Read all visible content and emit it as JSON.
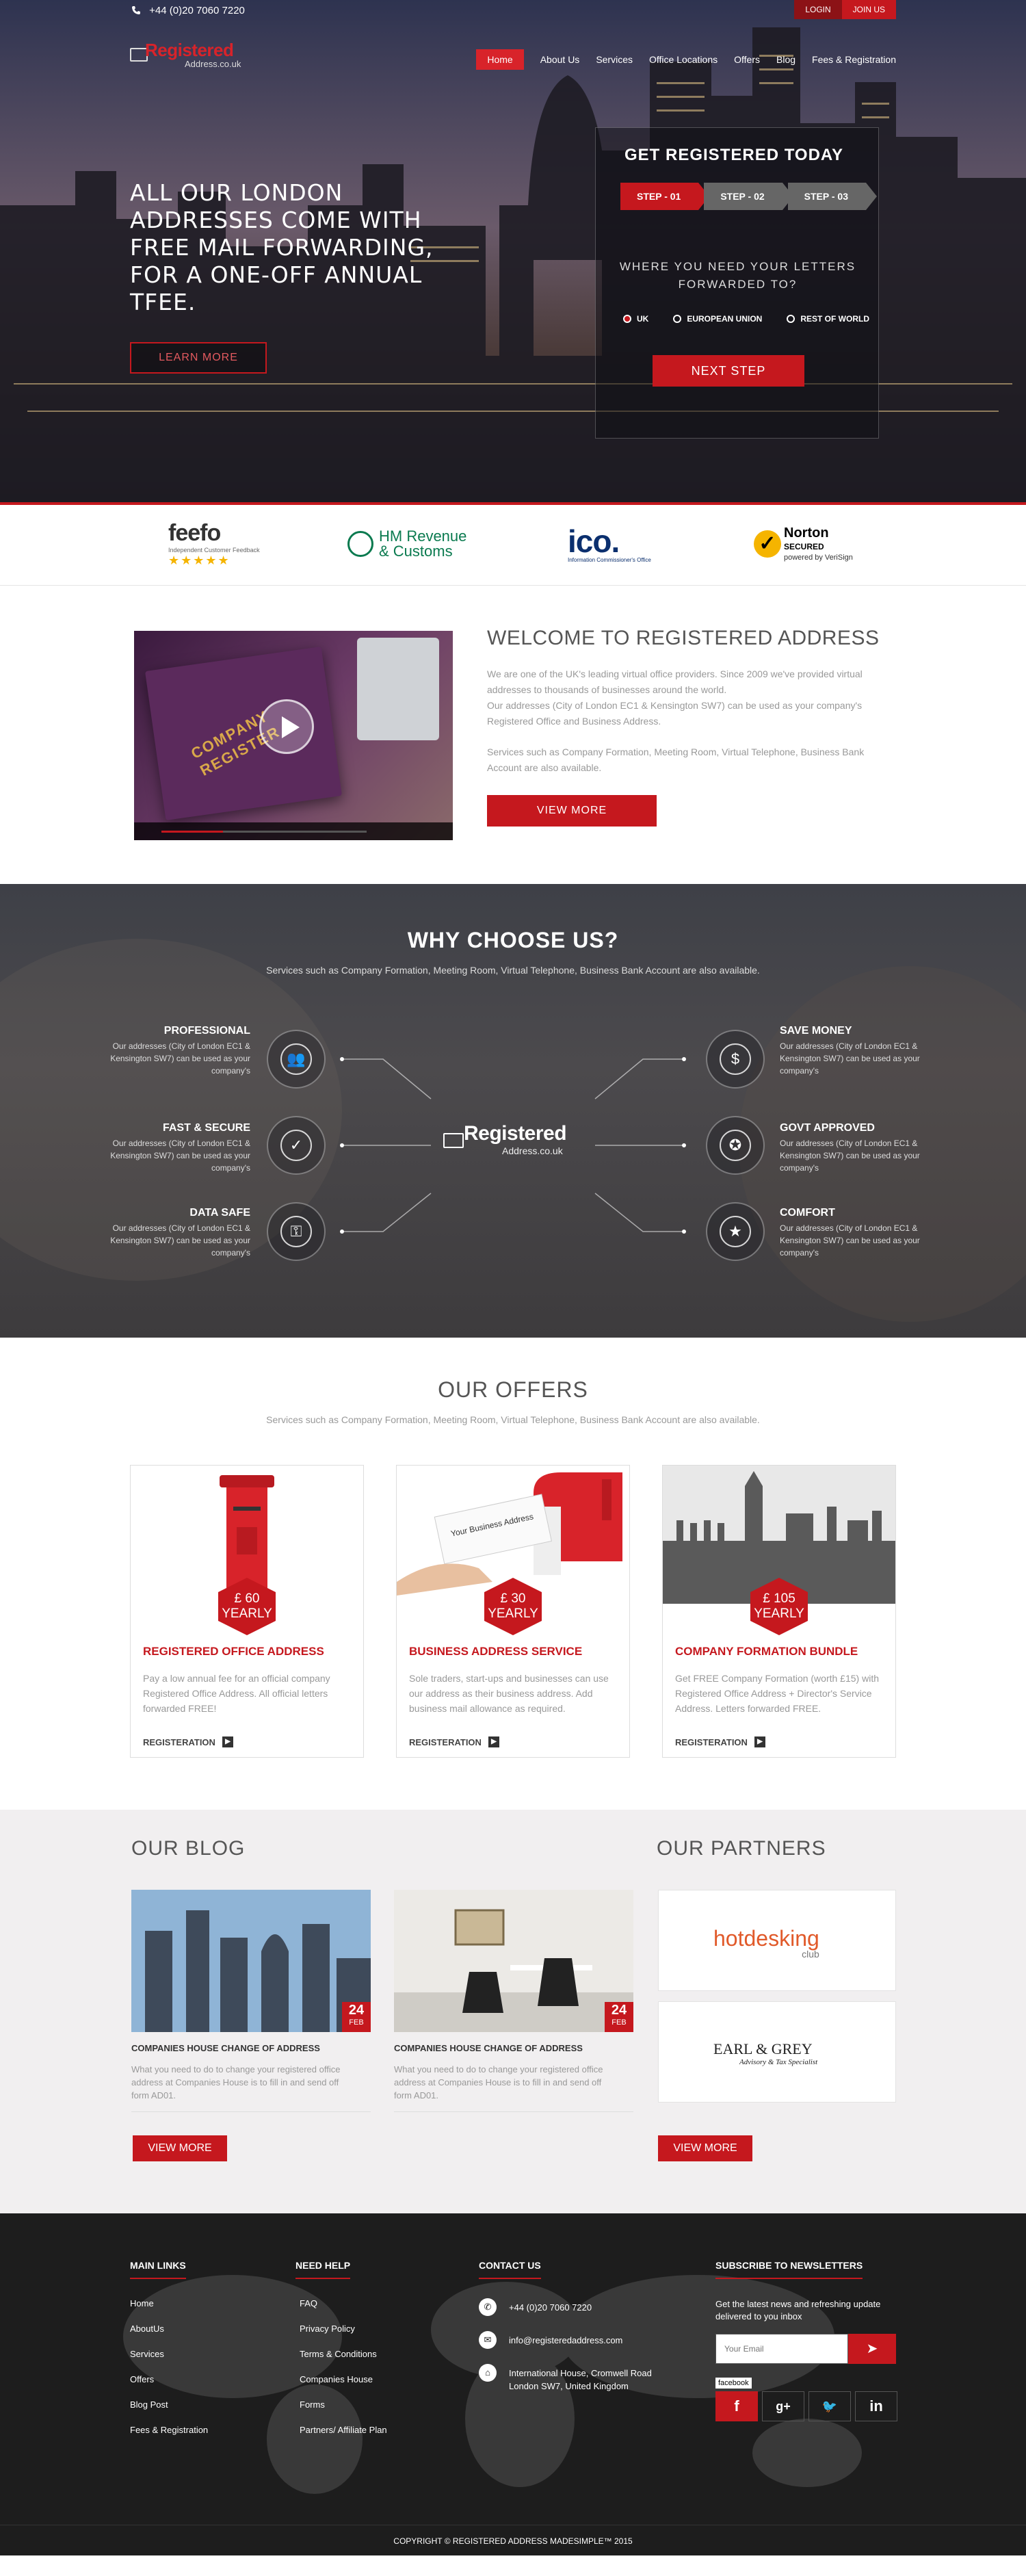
{
  "topbar": {
    "phone": "+44 (0)20 7060 7220",
    "login": "LOGIN",
    "join": "JOIN US"
  },
  "logo": {
    "brand": "Registered",
    "sub": "Address.co.uk"
  },
  "nav": {
    "items": [
      "Home",
      "About Us",
      "Services",
      "Office Locations",
      "Offers",
      "Blog",
      "Fees & Registration"
    ],
    "active": "Home"
  },
  "hero": {
    "headline": "ALL OUR LONDON ADDRESSES COME WITH FREE MAIL FORWARDING, FOR A ONE-OFF ANNUAL TFEE.",
    "learn_more": "LEARN MORE"
  },
  "register": {
    "title": "GET REGISTERED TODAY",
    "steps": [
      "STEP - 01",
      "STEP - 02",
      "STEP - 03"
    ],
    "question": "WHERE YOU NEED YOUR LETTERS FORWARDED TO?",
    "regions": [
      "UK",
      "EUROPEAN UNION",
      "REST OF WORLD"
    ],
    "next": "NEXT STEP"
  },
  "partners_strip": {
    "feefo": {
      "name": "feefo",
      "tag": "Independent Customer Feedback",
      "stars": "★★★★★"
    },
    "hmrc": {
      "line1": "HM Revenue",
      "line2": "& Customs"
    },
    "ico": {
      "name": "ico.",
      "tag": "Information Commissioner's Office"
    },
    "norton": {
      "name": "Norton",
      "line2": "SECURED",
      "tag": "powered by VeriSign"
    }
  },
  "welcome": {
    "title": "WELCOME TO REGISTERED ADDRESS",
    "p1": "We are one of the UK's leading virtual office providers. Since 2009 we've provided virtual addresses to thousands of businesses around the world.",
    "p2": "Our addresses (City of London EC1 & Kensington SW7) can be used as your company's Registered Office and Business Address.",
    "p3": "Services such as Company Formation, Meeting Room, Virtual Telephone, Business Bank Account are also available.",
    "button": "VIEW MORE",
    "video_text": "COMPANY REGISTER"
  },
  "why": {
    "title": "WHY CHOOSE US?",
    "subtitle": "Services such as Company Formation, Meeting Room, Virtual Telephone, Business Bank Account are also available.",
    "desc": "Our addresses (City of London EC1 & Kensington SW7) can be used as your company's",
    "left": [
      "PROFESSIONAL",
      "FAST & SECURE",
      "DATA SAFE"
    ],
    "right": [
      "SAVE MONEY",
      "GOVT APPROVED",
      "COMFORT"
    ],
    "icons_left": [
      "people-icon",
      "shield-check-icon",
      "usb-stick-icon"
    ],
    "icons_right": [
      "money-bag-icon",
      "certificate-icon",
      "document-star-icon"
    ]
  },
  "offers": {
    "title": "OUR OFFERS",
    "subtitle": "Services such as Company Formation, Meeting Room, Virtual Telephone, Business Bank Account are also available.",
    "cards": [
      {
        "price": "£ 60",
        "period": "YEARLY",
        "title": "REGISTERED OFFICE ADDRESS",
        "desc": "Pay a low annual fee for an official company Registered Office Address. All official letters forwarded FREE!",
        "link": "REGISTERATION"
      },
      {
        "price": "£ 30",
        "period": "YEARLY",
        "title": "BUSINESS ADDRESS SERVICE",
        "desc": "Sole traders, start-ups and businesses can use our address as their business address. Add business mail allowance as required.",
        "link": "REGISTERATION",
        "envelope": "Your Business Address"
      },
      {
        "price": "£ 105",
        "period": "YEARLY",
        "title": "COMPANY FORMATION BUNDLE",
        "desc": "Get FREE Company Formation (worth £15) with Registered Office Address + Director's Service Address. Letters forwarded FREE.",
        "link": "REGISTERATION"
      }
    ]
  },
  "blog": {
    "title": "OUR BLOG",
    "posts": [
      {
        "title": "COMPANIES HOUSE CHANGE OF ADDRESS",
        "day": "24",
        "month": "FEB",
        "desc": "What you need to do to change your registered office address at Companies House is to fill in and send off form AD01."
      },
      {
        "title": "COMPANIES HOUSE CHANGE OF ADDRESS",
        "day": "24",
        "month": "FEB",
        "desc": "What you need to do to change your registered office address at Companies House is to fill in and send off form AD01."
      }
    ],
    "button": "VIEW MORE"
  },
  "partners": {
    "title": "OUR  PARTNERS",
    "p1": {
      "name": "hotdesking",
      "sub": "club"
    },
    "p2": {
      "name": "EARL & GREY",
      "sub": "Advisory & Tax Specialist"
    },
    "button": "VIEW MORE"
  },
  "footer": {
    "main_links": {
      "title": "MAIN LINKS",
      "items": [
        "Home",
        "AboutUs",
        "Services",
        "Offers",
        "Blog Post",
        "Fees & Registration"
      ]
    },
    "need_help": {
      "title": "NEED HELP",
      "items": [
        "FAQ",
        "Privacy Policy",
        "Terms & Conditions",
        "Companies House",
        "Forms",
        "Partners/ Affiliate Plan"
      ]
    },
    "contact": {
      "title": "CONTACT US",
      "phone": "+44 (0)20 7060 7220",
      "email": "info@registeredaddress.com",
      "addr1": "International House, Cromwell Road",
      "addr2": "London SW7, United Kingdom"
    },
    "newsletter": {
      "title": "SUBSCRIBE TO NEWSLETTERS",
      "text": "Get the latest news and refreshing update delivered to you inbox",
      "placeholder": "Your Email",
      "fb_tag": "facebook"
    },
    "copyright": "COPYRIGHT © REGISTERED ADDRESS MADESIMPLE™ 2015"
  },
  "colors": {
    "accent": "#c5181e",
    "dark": "#1d1d1d",
    "light_bg": "#f1eff0"
  }
}
